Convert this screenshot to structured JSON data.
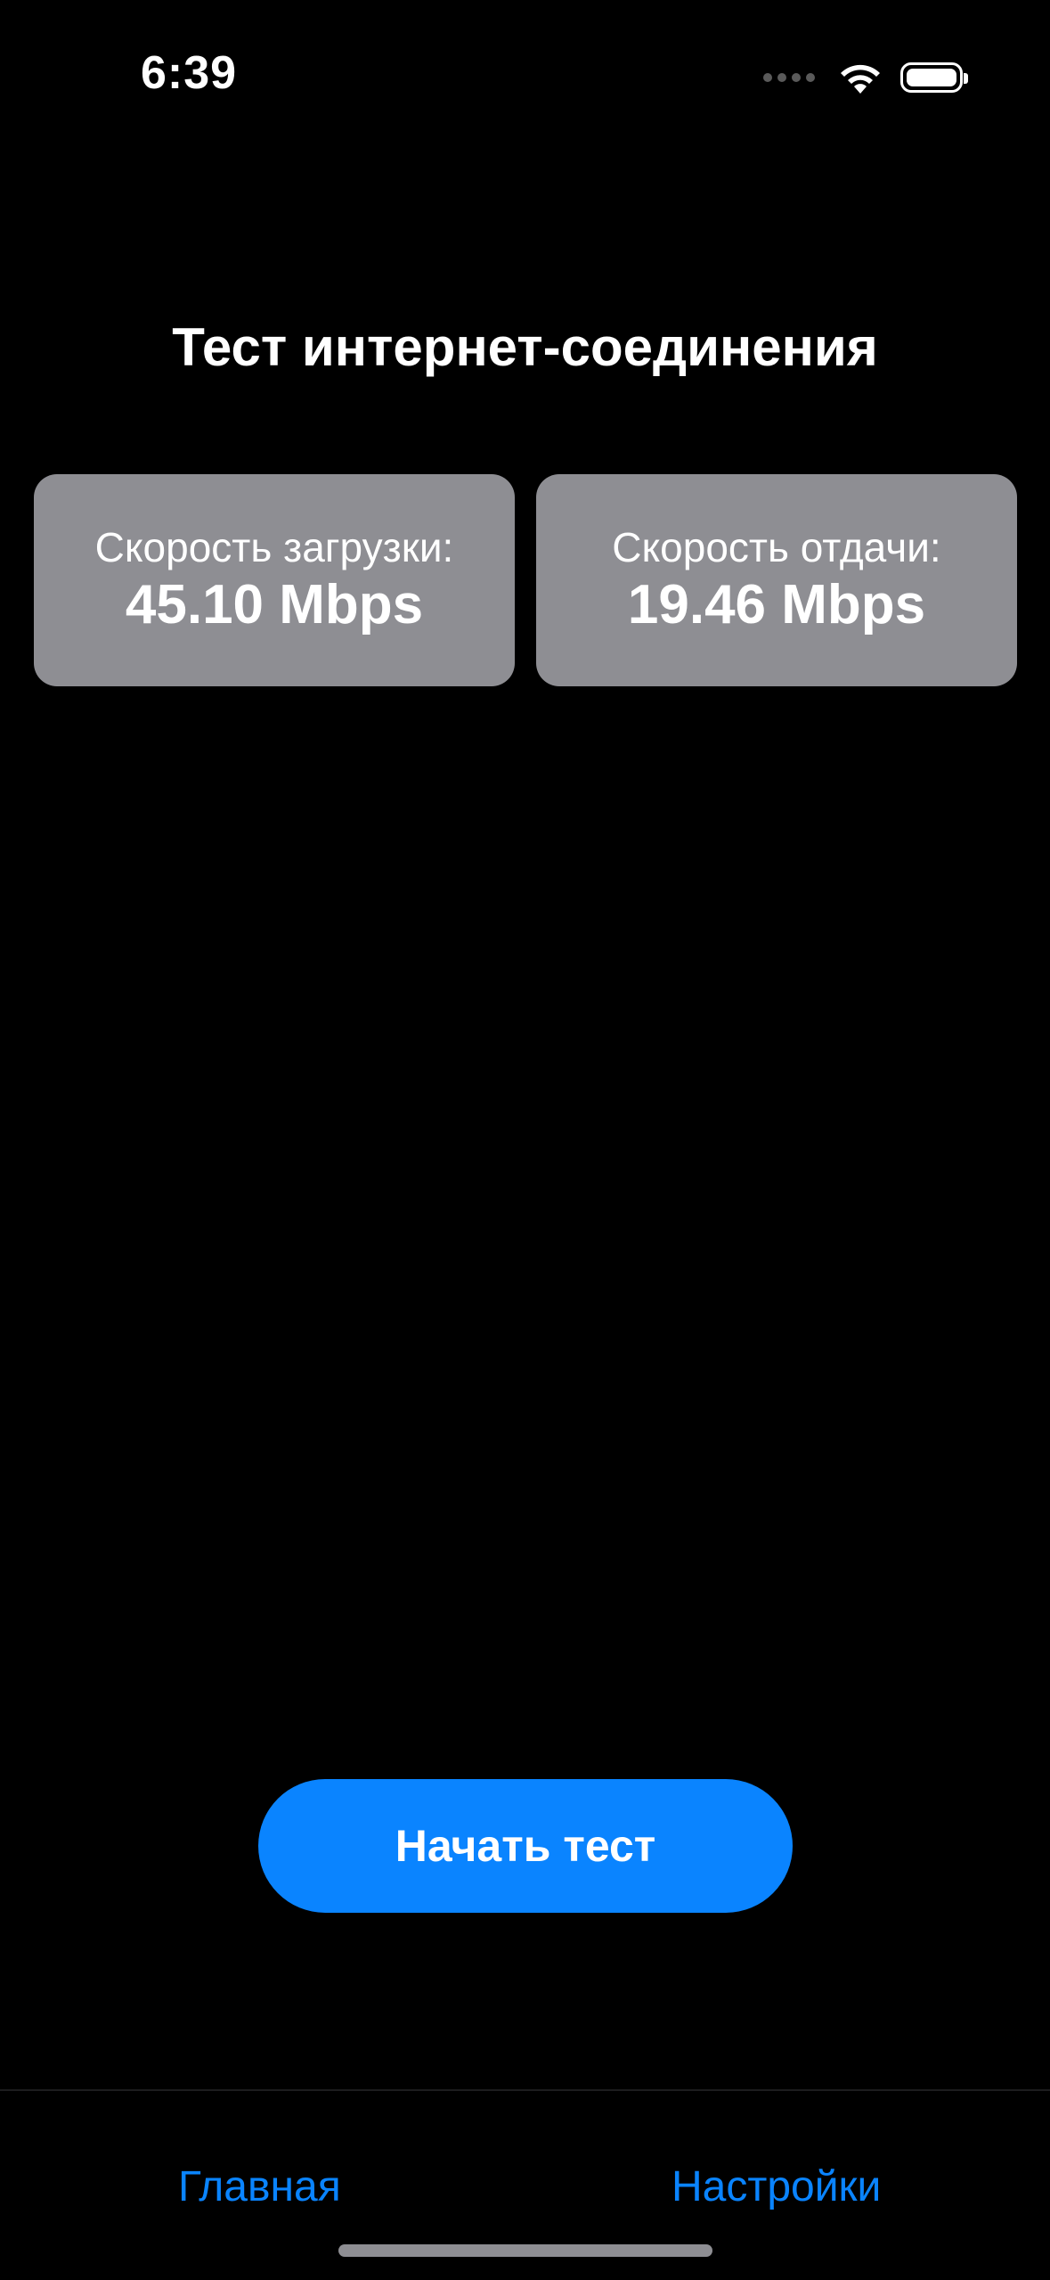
{
  "status_bar": {
    "time": "6:39",
    "icons": [
      "cellular-icon",
      "wifi-icon",
      "battery-icon"
    ]
  },
  "main": {
    "title": "Тест интернет-соединения",
    "download": {
      "label": "Скорость загрузки:",
      "value": "45.10 Mbps"
    },
    "upload": {
      "label": "Скорость отдачи:",
      "value": "19.46 Mbps"
    },
    "start_button_label": "Начать тест"
  },
  "tab_bar": {
    "items": [
      {
        "label": "Главная"
      },
      {
        "label": "Настройки"
      }
    ]
  },
  "colors": {
    "background": "#000000",
    "card": "#8e8e93",
    "accent": "#0a84ff",
    "text": "#ffffff"
  }
}
